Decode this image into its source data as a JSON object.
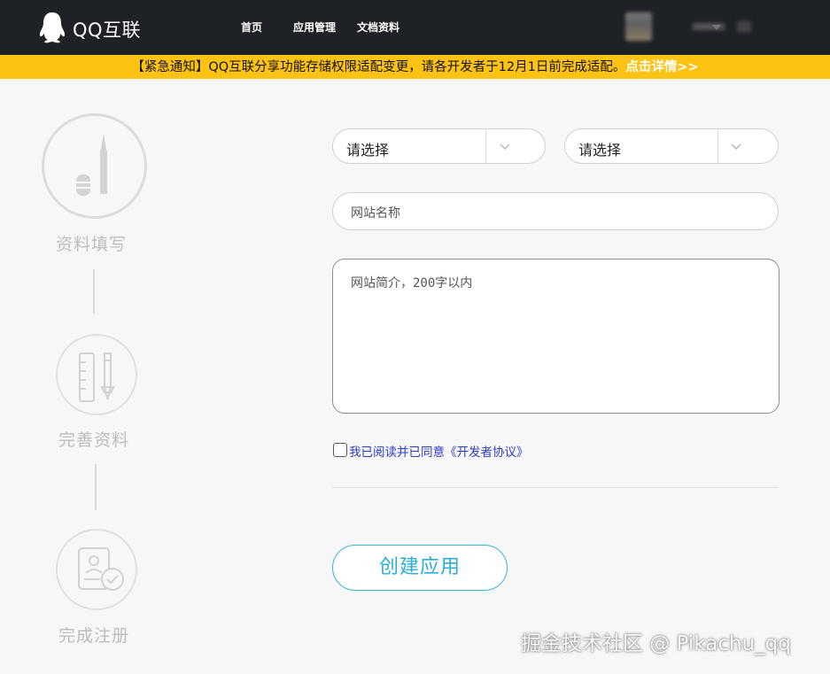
{
  "header": {
    "logo_text": "QQ互联",
    "nav": [
      "首页",
      "应用管理",
      "文档资料"
    ]
  },
  "notice": {
    "text": "【紧急通知】QQ互联分享功能存储权限适配变更，请各开发者于12月1日前完成适配。",
    "link": "点击详情>>"
  },
  "steps": [
    {
      "label": "资料填写",
      "icon": "pen-icon"
    },
    {
      "label": "完善资料",
      "icon": "ruler-pen-icon"
    },
    {
      "label": "完成注册",
      "icon": "id-card-check-icon"
    }
  ],
  "form": {
    "select_1": "请选择",
    "select_2": "请选择",
    "site_name_placeholder": "网站名称",
    "site_intro_placeholder": "网站简介，200字以内",
    "agreement": "我已阅读并已同意《开发者协议》",
    "submit": "创建应用"
  },
  "watermark": "掘金技术社区 @ Pikachu_qq",
  "colors": {
    "topbar": "#1e2227",
    "notice_bg": "#fcc214",
    "accent": "#2aaed6",
    "link": "#2b3cc4"
  }
}
